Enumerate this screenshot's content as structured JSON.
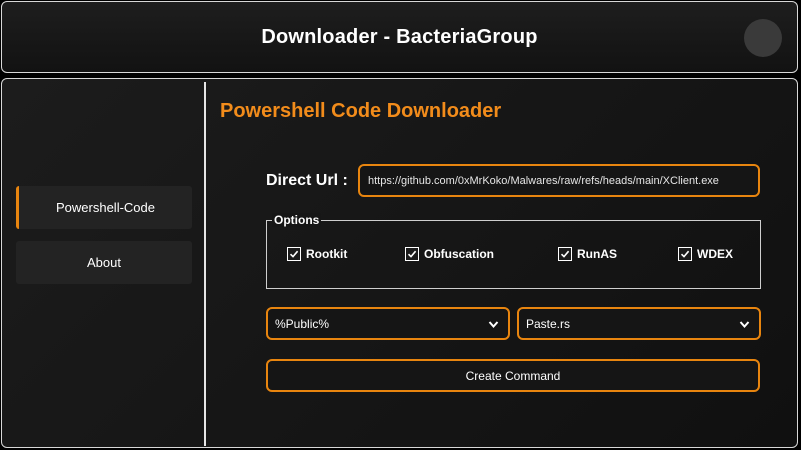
{
  "header": {
    "title": "Downloader - BacteriaGroup"
  },
  "sidebar": {
    "items": [
      {
        "label": "Powershell-Code",
        "active": true
      },
      {
        "label": "About",
        "active": false
      }
    ]
  },
  "main": {
    "title": "Powershell Code Downloader",
    "url_label": "Direct Url :",
    "url_value": "https://github.com/0xMrKoko/Malwares/raw/refs/heads/main/XClient.exe",
    "options": {
      "legend": "Options",
      "items": [
        {
          "label": "Rootkit",
          "checked": true
        },
        {
          "label": "Obfuscation",
          "checked": true
        },
        {
          "label": "RunAS",
          "checked": true
        },
        {
          "label": "WDEX",
          "checked": true
        }
      ]
    },
    "path_select": {
      "value": "%Public%",
      "icon": "chevron-down-icon"
    },
    "host_select": {
      "value": "Paste.rs",
      "icon": "chevron-down-icon"
    },
    "create_button": "Create Command"
  },
  "colors": {
    "accent": "#e8850f",
    "title_accent": "#f28c1b",
    "background": "#141414"
  }
}
